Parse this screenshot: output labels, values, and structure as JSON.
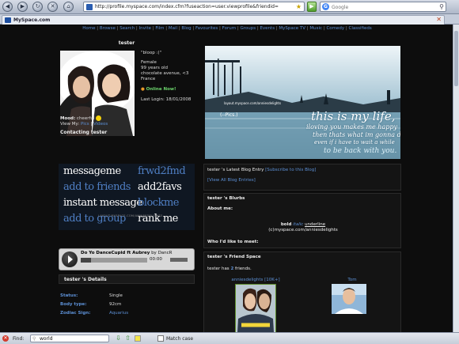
{
  "browser": {
    "url": "http://profile.myspace.com/index.cfm?fuseaction=user.viewprofile&friendid=",
    "search_placeholder": "Google",
    "tab_title": "MySpace.com",
    "nav_icons": [
      "back-icon",
      "forward-icon",
      "reload-icon",
      "stop-icon",
      "home-icon"
    ]
  },
  "nav": {
    "links": [
      "Home",
      "Browse",
      "Search",
      "Invite",
      "Film",
      "Mail",
      "Blog",
      "Favourites",
      "Forum",
      "Groups",
      "Events",
      "MySpace TV",
      "Music",
      "Comedy",
      "Classifieds"
    ]
  },
  "profile": {
    "name": "tester",
    "quote": "\"bloop :(\"",
    "gender": "Female",
    "age": "99 years old",
    "location": "chocolate avenue, <3",
    "country": "France",
    "online_now": "Online Now!",
    "last_login_label": "Last Login:",
    "last_login": "18/01/2008",
    "mood_label": "Mood:",
    "mood": "cheerful",
    "view_my_label": "View My:",
    "pics": "Pics",
    "videos": "Videos",
    "separator": "|"
  },
  "contacting": {
    "title": "Contacting tester",
    "items": [
      {
        "label": "messageme",
        "color": "#ffffff"
      },
      {
        "label": "frwd2fmd",
        "color": "#4f7fc4"
      },
      {
        "label": "add to friends",
        "color": "#4f7fc4"
      },
      {
        "label": "add2favs",
        "color": "#ffffff"
      },
      {
        "label": "instant message",
        "color": "#ffffff"
      },
      {
        "label": "blockme",
        "color": "#4f7fc4"
      },
      {
        "label": "add to group",
        "color": "#4f7fc4"
      },
      {
        "label": "rank me",
        "color": "#ffffff"
      }
    ],
    "credit": "LAYOUT.MYSPACE.COM/ANNIESDELIGHTS"
  },
  "player": {
    "song": "Do Yo DanceCupid ft Aubrey",
    "by_label": "by",
    "artist": "DancR",
    "time": "00:00",
    "progress": 0.15
  },
  "details": {
    "title": "tester 's Details",
    "rows": [
      {
        "key": "Status:",
        "value": "Single"
      },
      {
        "key": "Body type:",
        "value": "92cm"
      },
      {
        "key": "Zodiac Sign:",
        "value": "Aquarius"
      }
    ]
  },
  "banner": {
    "pics_label": "(--Pics.)",
    "lines": [
      "this is my life,",
      "iloving you makes me happy",
      "then thats what im gonna do",
      "even if i have to wait a while",
      "to be back with you."
    ],
    "small_text": "layout.myspace.com/anniesdelights"
  },
  "blog": {
    "latest_label": "tester 's Latest Blog Entry",
    "subscribe": "[Subscribe to this Blog]",
    "view_all": "[View All Blog Entries]"
  },
  "blurbs": {
    "title": "tester 's Blurbs",
    "about_me_label": "About me:",
    "line1_bold": "bold",
    "line1_italic": "italic",
    "line1_underline": "underline",
    "line2": "(c)myspace.com/anniesdelights",
    "meet_label": "Who I'd like to meet:"
  },
  "friendspace": {
    "title": "tester 's Friend Space",
    "count_prefix": "tester has",
    "count": "2",
    "count_suffix": "friends.",
    "friends": [
      {
        "name": "anniesdelights [10K+]"
      },
      {
        "name": "Tom"
      }
    ]
  },
  "findbar": {
    "label": "Find:",
    "query": "world",
    "match_case": "Match case"
  }
}
